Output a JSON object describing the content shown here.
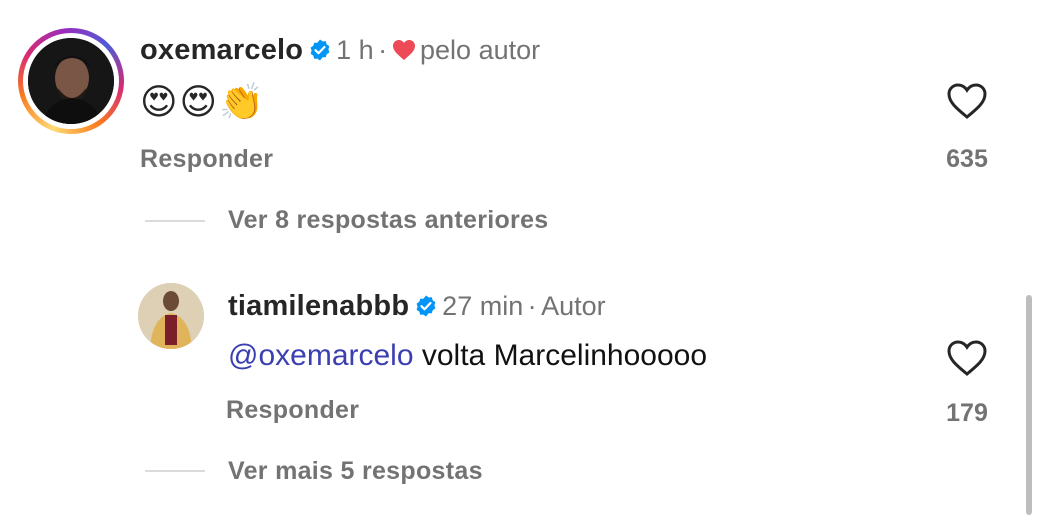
{
  "comment1": {
    "username": "oxemarcelo",
    "time": "1 h",
    "separator": "·",
    "liked_by_author": "pelo autor",
    "emojis": "😍😍👏",
    "reply_label": "Responder",
    "likes": "635"
  },
  "thread": {
    "view_previous": "Ver 8 respostas anteriores",
    "view_more": "Ver mais 5 respostas"
  },
  "comment2": {
    "username": "tiamilenabbb",
    "time": "27 min",
    "separator": "·",
    "author_badge": "Autor",
    "mention": "@oxemarcelo",
    "text": " volta Marcelinhooooo",
    "reply_label": "Responder",
    "likes": "179"
  },
  "colors": {
    "verified": "#0095f6",
    "heart": "#ed4956",
    "mention": "#3b3fb0",
    "secondary_text": "#737373"
  }
}
